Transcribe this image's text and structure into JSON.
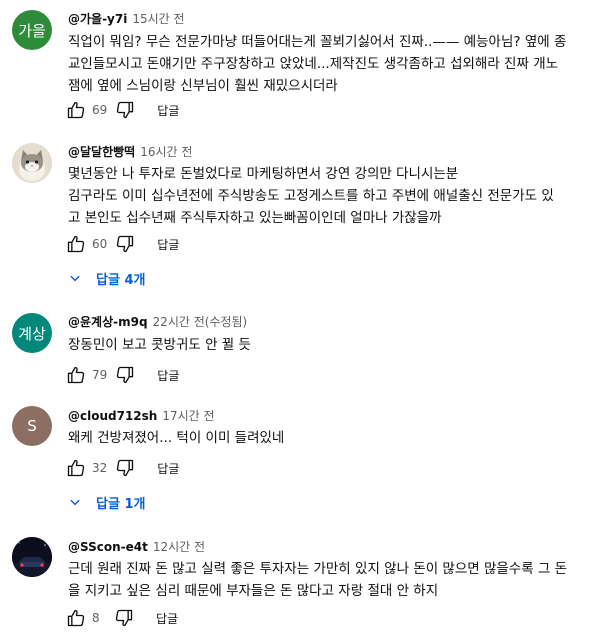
{
  "comments": [
    {
      "avatar_text": "가을",
      "avatar_color": "#2e8b3a",
      "handle": "@가을-y7i",
      "time": "15시간 전",
      "lines": [
        "직업이 뭐임? 무슨 전문가마냥 떠들어대는게 꼴뵈기싫어서 진짜..—— 예능아님? 옆에 종",
        "교인들모시고 돈얘기만 주구장창하고 앉았네...제작진도 생각좀하고 섭외해라 진짜 개노",
        "잼에 옆에 스님이랑 신부님이 훨씬 재밌으시더라"
      ],
      "likes": "69",
      "reply_label": "답글"
    },
    {
      "avatar_text": "",
      "avatar_color": "#d8d2c6",
      "handle": "@달달한빵떡",
      "time": "16시간 전",
      "lines": [
        "몇년동안 나 투자로 돈벌었다로 마케팅하면서 강연 강의만 다니시는분",
        "김구라도 이미 십수년전에 주식방송도 고정게스트를 하고 주변에 애널출신 전문가도 있",
        "고 본인도 십수년째 주식투자하고 있는빠꼼이인데 얼마나 가잖을까"
      ],
      "likes": "60",
      "reply_label": "답글",
      "replies_label": "답글 4개"
    },
    {
      "avatar_text": "계상",
      "avatar_color": "#00897b",
      "handle": "@윤계상-m9q",
      "time": "22시간 전(수정됨)",
      "lines": [
        "장동민이 보고 콧방귀도 안 뀔 듯"
      ],
      "likes": "79",
      "reply_label": "답글"
    },
    {
      "avatar_text": "S",
      "avatar_color": "#8d6e63",
      "handle": "@cloud712sh",
      "time": "17시간 전",
      "lines": [
        "왜케 건방져졌어... 턱이 이미 들려있네"
      ],
      "likes": "32",
      "reply_label": "답글",
      "replies_label": "답글 1개"
    },
    {
      "avatar_text": "",
      "avatar_color": "#0b0e1e",
      "handle": "@SScon-e4t",
      "time": "12시간 전",
      "lines": [
        "근데 원래 진짜 돈 많고 실력 좋은 투자자는 가만히 있지 않나 돈이 많으면 많을수록 그 돈",
        "을 지키고 싶은 심리 때문에 부자들은 돈 많다고 자랑 절대 안 하지"
      ],
      "likes": "8",
      "reply_label": "답글"
    }
  ],
  "icons": {
    "like": "thumb-up-icon",
    "dislike": "thumb-down-icon",
    "replies": "chevron-down-icon"
  },
  "colors": {
    "link_blue": "#065fd4",
    "meta_gray": "#606060"
  }
}
